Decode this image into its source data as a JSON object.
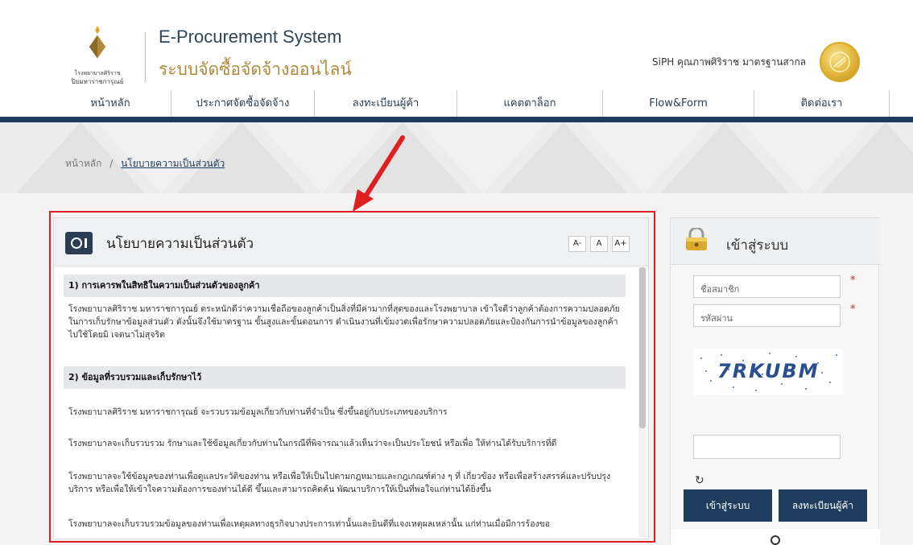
{
  "header": {
    "logo_text_line1": "โรงพยาบาลศิริราช",
    "logo_text_line2": "ปิยมหาราชการุณย์",
    "title_en": "E-Procurement System",
    "title_th": "ระบบจัดซื้อจัดจ้างออนไลน์",
    "quality_label": "SiPH คุณภาพศิริราช มาตรฐานสากล"
  },
  "nav": {
    "items": [
      {
        "label": "หน้าหลัก"
      },
      {
        "label": "ประกาศจัดซื้อจัดจ้าง"
      },
      {
        "label": "ลงทะเบียนผู้ค้า"
      },
      {
        "label": "แคตตาล็อก"
      },
      {
        "label": "Flow&Form"
      },
      {
        "label": "ติดต่อเรา"
      }
    ]
  },
  "breadcrumb": {
    "home": "หน้าหลัก",
    "separator": "/",
    "current": "นโยบายความเป็นส่วนตัว"
  },
  "privacy": {
    "title": "นโยบายความเป็นส่วนตัว",
    "font_buttons": [
      "A-",
      "A",
      "A+"
    ],
    "sections": [
      {
        "heading": "1) การเคารพในสิทธิในความเป็นส่วนตัวของลูกค้า",
        "paragraphs": [
          "โรงพยาบาลศิริราช มหาราชการุณย์ ตระหนักดีว่าความเชื่อถือของลูกค้าเป็นสิ่งที่มีค่ามากที่สุดของและโรงพยาบาล เข้าใจดีว่าลูกค้าต้องการความปลอดภัยในการเก็บรักษาข้อมูลส่วนตัว ดังนั้นจึงใช้มาตรฐาน ขั้นสูงและขั้นตอนการ ดำเนินงานที่เข้มงวดเพื่อรักษาความปลอดภัยและป้องกันการนำข้อมูลของลูกค้าไปใช้โดยมิ เจตนาไม่สุจริต"
        ]
      },
      {
        "heading": "2) ข้อมูลที่รวบรวมและเก็บรักษาไว้",
        "paragraphs": [
          "โรงพยาบาลศิริราช มหาราชการุณย์ จะรวบรวมข้อมูลเกี่ยวกับท่านที่จำเป็น ซึ่งขึ้นอยู่กับประเภทของบริการ",
          "โรงพยาบาลจะเก็บรวบรวม รักษาและใช้ข้อมูลเกี่ยวกับท่านในกรณีที่พิจารณาแล้วเห็นว่าจะเป็นประโยชน์ หรือเพื่อ ให้ท่านได้รับบริการที่ดี",
          "โรงพยาบาลจะใช้ข้อมูลของท่านเพื่อดูแลประวัติของท่าน หรือเพื่อให้เป็นไปตามกฎหมายและกฎเกณฑ์ต่าง ๆ ที่ เกี่ยวข้อง หรือเพื่อสร้างสรรค์และปรับปรุงบริการ หรือเพื่อให้เข้าใจความต้องการของท่านได้ดี ขึ้นและสามารถคิดค้น พัฒนาบริการให้เป็นที่พอใจแก่ท่านได้ยิ่งขึ้น",
          "โรงพยาบาลจะเก็บรวบรวมข้อมูลของท่านเพื่อเหตุผลทางธุรกิจบางประการเท่านั้นและยินดีที่แจงเหตุผลเหล่านั้น แก่ท่านเมื่อมีการร้องขอ"
        ]
      }
    ]
  },
  "login": {
    "title": "เข้าสู่ระบบ",
    "username_placeholder": "ชื่อสมาชิก",
    "password_placeholder": "รหัสผ่าน",
    "required_mark": "*",
    "captcha_text": "7RKUBM",
    "refresh_icon": "↻",
    "login_button": "เข้าสู่ระบบ",
    "register_button": "ลงทะเบียนผู้ค้า"
  },
  "colors": {
    "navy": "#1f3d5f",
    "gold": "#b08a3a",
    "annotation_red": "#e02020"
  }
}
